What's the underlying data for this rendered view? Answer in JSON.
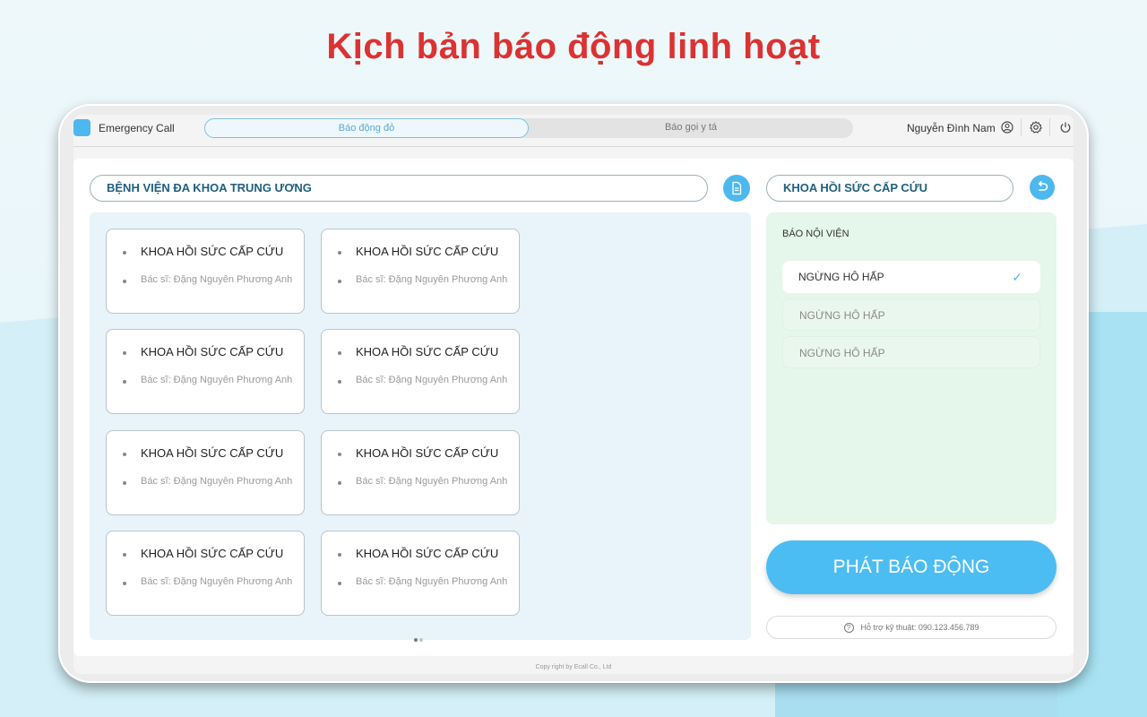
{
  "headline": "Kịch bản báo động linh hoạt",
  "topbar": {
    "app_name": "Emergency Call",
    "tabs": [
      {
        "label": "Báo động đỏ",
        "active": true
      },
      {
        "label": "Báo gọi y tá",
        "active": false
      }
    ],
    "user_name": "Nguyễn Đình Nam",
    "icons": [
      "user-icon",
      "gear-icon",
      "power-icon"
    ]
  },
  "left": {
    "hospital_name": "BỆNH VIỆN ĐA KHOA TRUNG ƯƠNG",
    "cards": [
      {
        "title": "KHOA HỒI SỨC CẤP CỨU",
        "doctor": "Bác sĩ: Đặng Nguyên Phương Anh"
      },
      {
        "title": "KHOA HỒI SỨC CẤP CỨU",
        "doctor": "Bác sĩ: Đặng Nguyên Phương Anh"
      },
      {
        "title": "KHOA HỒI SỨC CẤP CỨU",
        "doctor": "Bác sĩ: Đặng Nguyên Phương Anh"
      },
      {
        "title": "KHOA HỒI SỨC CẤP CỨU",
        "doctor": "Bác sĩ: Đặng Nguyên Phương Anh"
      },
      {
        "title": "KHOA HỒI SỨC CẤP CỨU",
        "doctor": "Bác sĩ: Đặng Nguyên Phương Anh"
      },
      {
        "title": "KHOA HỒI SỨC CẤP CỨU",
        "doctor": "Bác sĩ: Đặng Nguyên Phương Anh"
      },
      {
        "title": "KHOA HỒI SỨC CẤP CỨU",
        "doctor": "Bác sĩ: Đặng Nguyên Phương Anh"
      },
      {
        "title": "KHOA HỒI SỨC CẤP CỨU",
        "doctor": "Bác sĩ: Đặng Nguyên Phương Anh"
      }
    ],
    "pager": {
      "pages": 2,
      "current": 1
    }
  },
  "right": {
    "department": "KHOA HỒI SỨC CẤP CỨU",
    "alert_heading": "BÁO NỘI VIỆN",
    "alert_options": [
      {
        "label": "NGỪNG HÔ HẤP",
        "selected": true
      },
      {
        "label": "NGỪNG HÔ HẤP",
        "selected": false
      },
      {
        "label": "NGỪNG HÔ HẤP",
        "selected": false
      }
    ],
    "fire_button": "PHÁT BÁO ĐỘNG",
    "support": "Hỗ trợ kỹ thuật: 090.123.456.789"
  },
  "copyright": "Copy right by Ecall Co., Ltd",
  "colors": {
    "headline": "#dc3232",
    "accent": "#4db8ee",
    "title_text": "#1f5f7e",
    "alert_panel": "#e5f6ea"
  }
}
